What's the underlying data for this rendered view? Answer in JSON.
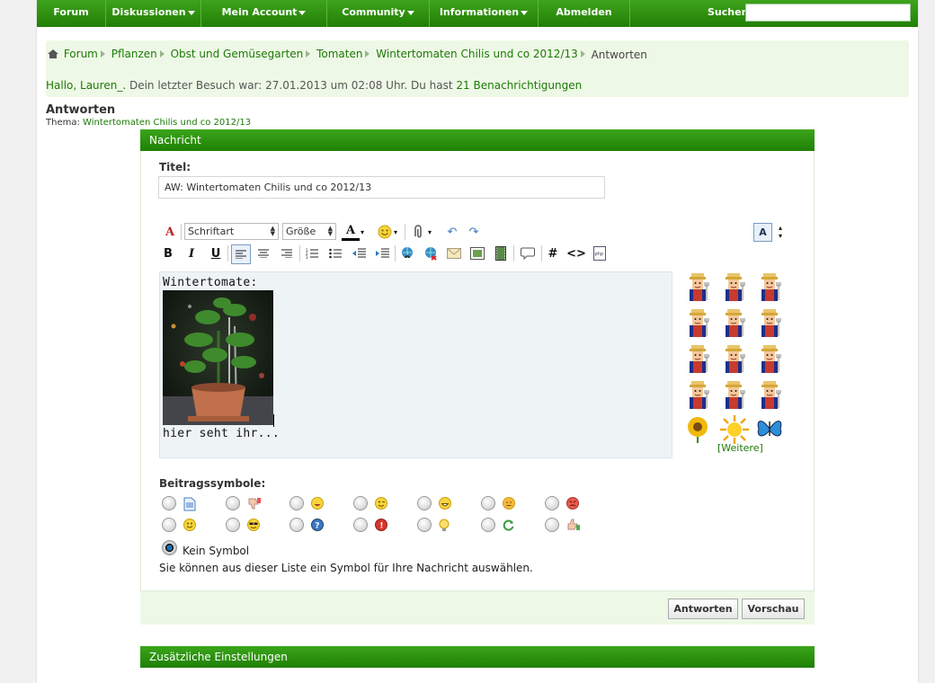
{
  "nav": {
    "items": [
      {
        "label": "Forum",
        "dropdown": false
      },
      {
        "label": "Diskussionen",
        "dropdown": true
      },
      {
        "label": "Mein Account",
        "dropdown": true
      },
      {
        "label": "Community",
        "dropdown": true
      },
      {
        "label": "Informationen",
        "dropdown": true
      },
      {
        "label": "Abmelden",
        "dropdown": false
      }
    ],
    "search_label": "Suchen",
    "search_value": ""
  },
  "breadcrumb": {
    "items": [
      "Forum",
      "Pflanzen",
      "Obst und Gemüsegarten",
      "Tomaten",
      "Wintertomaten Chilis und co 2012/13"
    ],
    "current": "Antworten"
  },
  "welcome": {
    "prefix": "Hallo, Lauren_.",
    "middle": " Dein letzter Besuch war: 27.01.2013 um 02:08 Uhr. Du hast ",
    "link": "21 Benachrichtigungen"
  },
  "page": {
    "title": "Antworten",
    "thema_label": "Thema:",
    "thema_link": "Wintertomaten Chilis und co 2012/13"
  },
  "message_panel": {
    "header": "Nachricht",
    "title_label": "Titel:",
    "title_value": "AW: Wintertomaten Chilis und co 2012/13",
    "font_select": "Schriftart",
    "size_select": "Größe",
    "editor_line1": "Wintertomate:",
    "editor_line2": "hier seht ihr...",
    "smilies_more": "[Weitere]",
    "symbols_label": "Beitragssymbole:",
    "no_symbol": "Kein Symbol",
    "symbols_hint": "Sie können aus dieser Liste ein Symbol für Ihre Nachricht auswählen.",
    "submit": "Antworten",
    "preview": "Vorschau"
  },
  "extra_panel": {
    "header": "Zusätzliche Einstellungen"
  },
  "colors": {
    "nav_green": "#2b8f0f",
    "link_green": "#1c7a06",
    "light_green_bg": "#eef8e6"
  }
}
